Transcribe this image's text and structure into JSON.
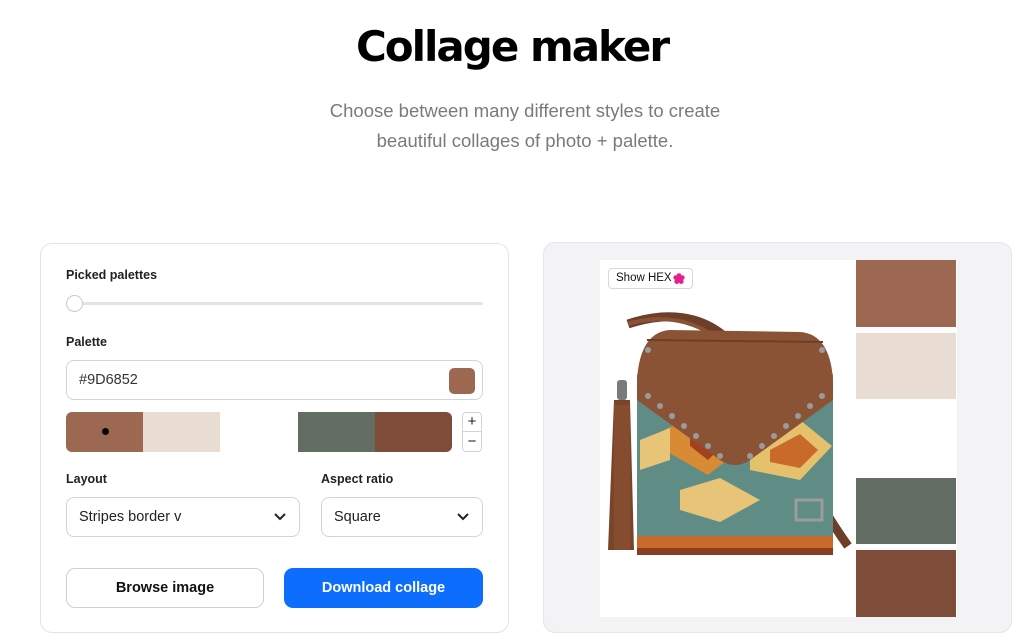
{
  "header": {
    "title": "Collage maker",
    "subtitle_line1": "Choose between many different styles to create",
    "subtitle_line2": "beautiful collages of photo + palette."
  },
  "controls": {
    "picked_palettes_label": "Picked palettes",
    "picked_palettes_value": 0,
    "palette_label": "Palette",
    "hex_value": "#9D6852",
    "palette_colors": [
      "#9D6852",
      "#E8DCD3",
      "#FFFFFF",
      "#626E64",
      "#7E4C39"
    ],
    "selected_color_index": 0,
    "plus_label": "+",
    "minus_label": "−",
    "layout_label": "Layout",
    "layout_value": "Stripes border v",
    "aspect_label": "Aspect ratio",
    "aspect_value": "Square",
    "browse_label": "Browse image",
    "download_label": "Download collage"
  },
  "preview": {
    "show_hex_label": "Show HEX",
    "stripe_colors": [
      "#9D6852",
      "#E8DCD3",
      "#FFFFFF",
      "#626E64",
      "#7E4C39"
    ]
  },
  "colors": {
    "accent": "#0D6EFD",
    "flower_icon": "#E91E8C"
  }
}
